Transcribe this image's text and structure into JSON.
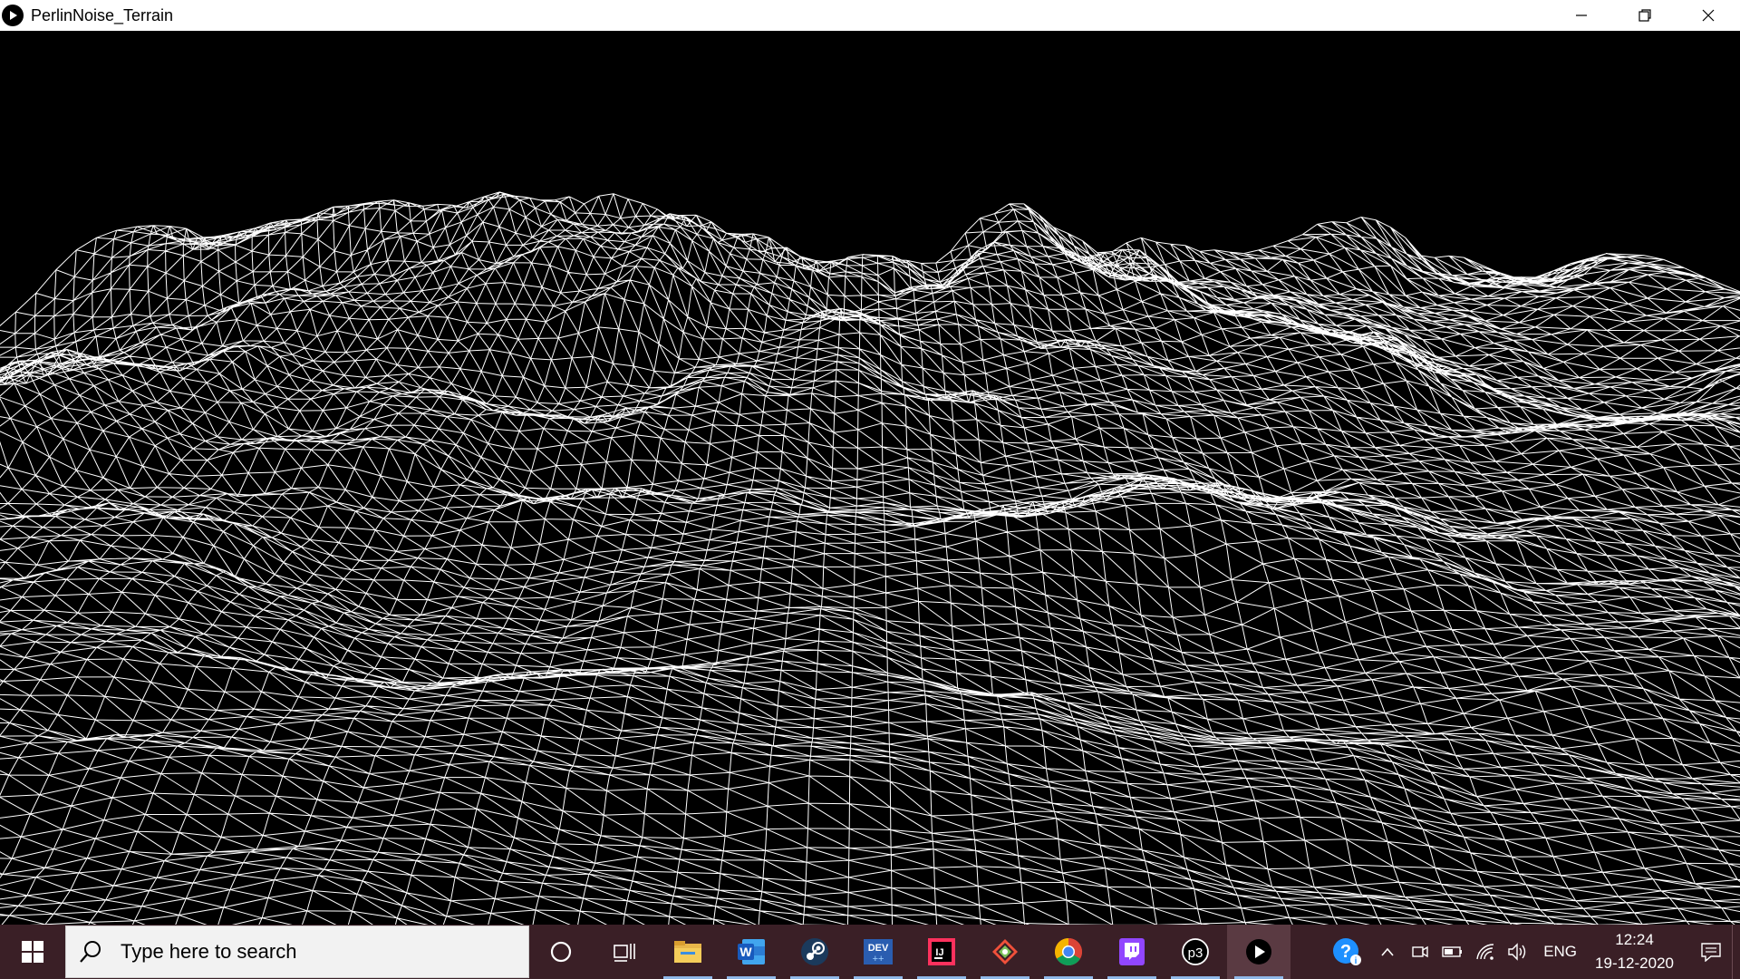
{
  "window": {
    "title": "PerlinNoise_Terrain",
    "controls": [
      "minimize",
      "restore",
      "close"
    ]
  },
  "canvas": {
    "background": "#000000",
    "mesh_color": "#ffffff",
    "content": "perlin-noise-wireframe-terrain"
  },
  "taskbar": {
    "background": "#3a1f26",
    "search": {
      "placeholder": "Type here to search"
    },
    "pinned": [
      {
        "name": "cortana-icon"
      },
      {
        "name": "task-view-icon"
      },
      {
        "name": "file-explorer-icon"
      },
      {
        "name": "word-icon",
        "label": "W"
      },
      {
        "name": "steam-icon"
      },
      {
        "name": "devcpp-icon",
        "label": "DEV"
      },
      {
        "name": "intellij-icon",
        "label": "IJ"
      },
      {
        "name": "git-icon"
      },
      {
        "name": "chrome-icon"
      },
      {
        "name": "twitch-icon"
      },
      {
        "name": "processing-icon",
        "label": "p3"
      },
      {
        "name": "running-app-icon"
      }
    ],
    "tray": {
      "language": "ENG",
      "time": "12:24",
      "date": "19-12-2020"
    }
  }
}
